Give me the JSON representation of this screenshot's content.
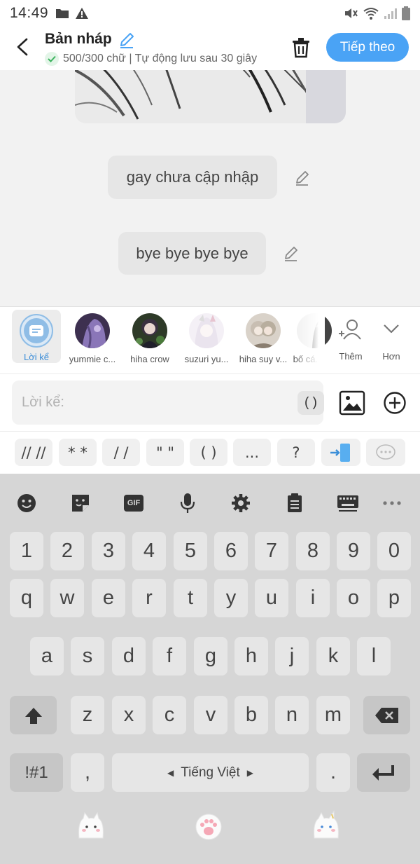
{
  "status_bar": {
    "time": "14:49"
  },
  "header": {
    "title": "Bản nháp",
    "subtitle": "500/300 chữ | Tự động lưu sau 30 giây",
    "next_label": "Tiếp theo",
    "accent": "#4aa3f5"
  },
  "messages": [
    {
      "text": "gay chưa cập nhập"
    },
    {
      "text": "bye bye bye bye"
    }
  ],
  "characters": {
    "narrator_label": "Lời kể",
    "items": [
      {
        "name": "yummie c..."
      },
      {
        "name": "hiha crow"
      },
      {
        "name": "suzuri yu..."
      },
      {
        "name": "hiha suy v..."
      },
      {
        "name": "bố cá..."
      }
    ],
    "add_label": "Thêm",
    "more_label": "Hơn"
  },
  "input": {
    "placeholder": "Lời kể:",
    "paren_chip": "( )"
  },
  "symbols": [
    "// //",
    "* *",
    "/ /",
    "\" \"",
    "( )",
    "...",
    "?"
  ],
  "keyboard": {
    "row_numbers": [
      "1",
      "2",
      "3",
      "4",
      "5",
      "6",
      "7",
      "8",
      "9",
      "0"
    ],
    "row_1": [
      "q",
      "w",
      "e",
      "r",
      "t",
      "y",
      "u",
      "i",
      "o",
      "p"
    ],
    "row_2": [
      "a",
      "s",
      "d",
      "f",
      "g",
      "h",
      "j",
      "k",
      "l"
    ],
    "row_3": [
      "z",
      "x",
      "c",
      "v",
      "b",
      "n",
      "m"
    ],
    "symbols_key": "!#1",
    "comma": ",",
    "period": ".",
    "space_label": "Tiếng Việt",
    "gif_label": "GIF"
  }
}
